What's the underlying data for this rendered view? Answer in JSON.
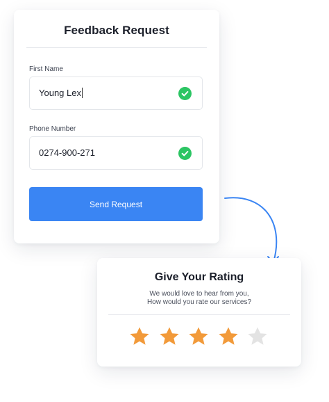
{
  "form": {
    "title": "Feedback Request",
    "first_name": {
      "label": "First Name",
      "value": "Young Lex"
    },
    "phone": {
      "label": "Phone Number",
      "value": "0274-900-271"
    },
    "submit_label": "Send Request"
  },
  "rating": {
    "title": "Give Your Rating",
    "subtitle_line1": "We would love to hear from you,",
    "subtitle_line2": "How would you rate our services?",
    "value": 4,
    "max": 5
  },
  "colors": {
    "accent": "#3a85f3",
    "success": "#2cc563",
    "star_filled": "#f29a3a",
    "star_empty": "#e3e3e3"
  },
  "icons": {
    "valid": "check-circle-icon",
    "rating": "star-icon",
    "connector": "curved-arrow-icon"
  }
}
